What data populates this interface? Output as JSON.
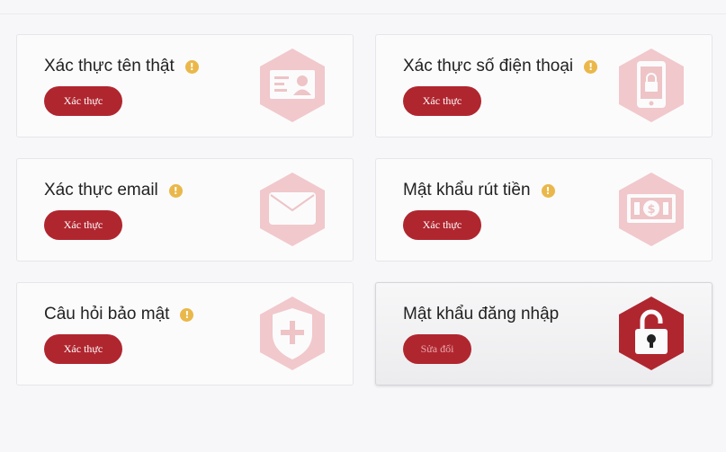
{
  "cards": [
    {
      "title": "Xác thực tên thật",
      "warning": "!",
      "button": "Xác thực",
      "icon": "id-card-icon"
    },
    {
      "title": "Xác thực số điện thoại",
      "warning": "!",
      "button": "Xác thực",
      "icon": "phone-lock-icon"
    },
    {
      "title": "Xác thực email",
      "warning": "!",
      "button": "Xác thực",
      "icon": "envelope-icon"
    },
    {
      "title": "Mật khẩu rút tiền",
      "warning": "!",
      "button": "Xác thực",
      "icon": "banknote-icon"
    },
    {
      "title": "Câu hỏi bảo mật",
      "warning": "!",
      "button": "Xác thực",
      "icon": "shield-plus-icon"
    },
    {
      "title": "Mật khẩu đăng nhập",
      "button": "Sửa đổi",
      "icon": "unlocked-padlock-icon"
    }
  ],
  "colors": {
    "accent": "#b0262f",
    "warning": "#eab84a",
    "hex_inactive": "#f1c8cb",
    "hex_active": "#b0262f"
  }
}
